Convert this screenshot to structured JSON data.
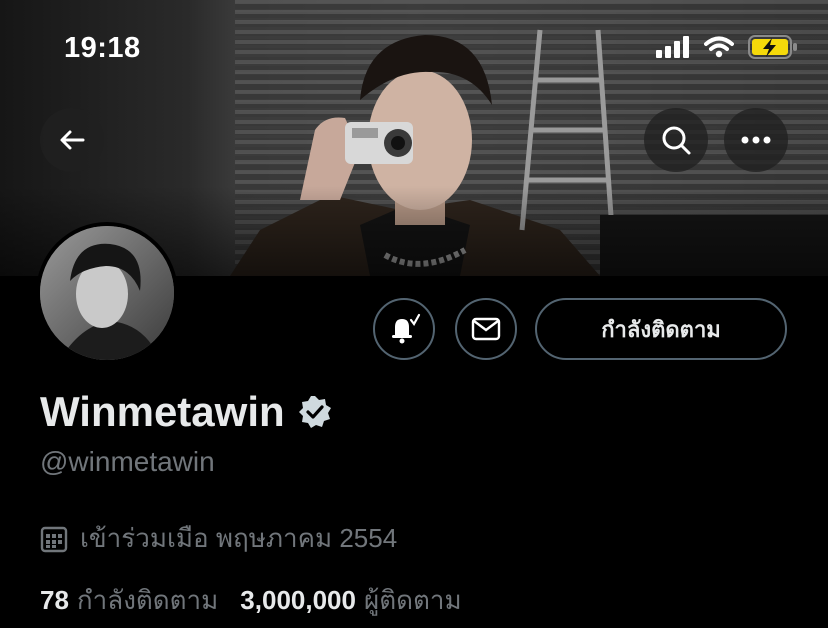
{
  "status_bar": {
    "time": "19:18",
    "icons": [
      "signal-icon",
      "wifi-icon",
      "battery-charging-icon"
    ]
  },
  "header": {
    "buttons": [
      "back-arrow-icon",
      "search-icon",
      "more-icon"
    ]
  },
  "profile": {
    "display_name": "Winmetawin",
    "handle": "@winmetawin",
    "verified": true,
    "joined": "เข้าร่วมเมือ พฤษภาคม 2554",
    "following_count": "78",
    "following_label": "กำลังติดตาม",
    "followers_count": "3,000,000",
    "followers_label": "ผู้ติดตาม"
  },
  "actions": {
    "follow_button_label": "กำลังติดตาม",
    "icons": [
      "bell-subscribed-icon",
      "mail-icon"
    ]
  },
  "colors": {
    "background": "#000000",
    "primary_text": "#e7e9ea",
    "secondary_text": "#71767b",
    "border": "#536471",
    "battery": "#f5d90a"
  }
}
